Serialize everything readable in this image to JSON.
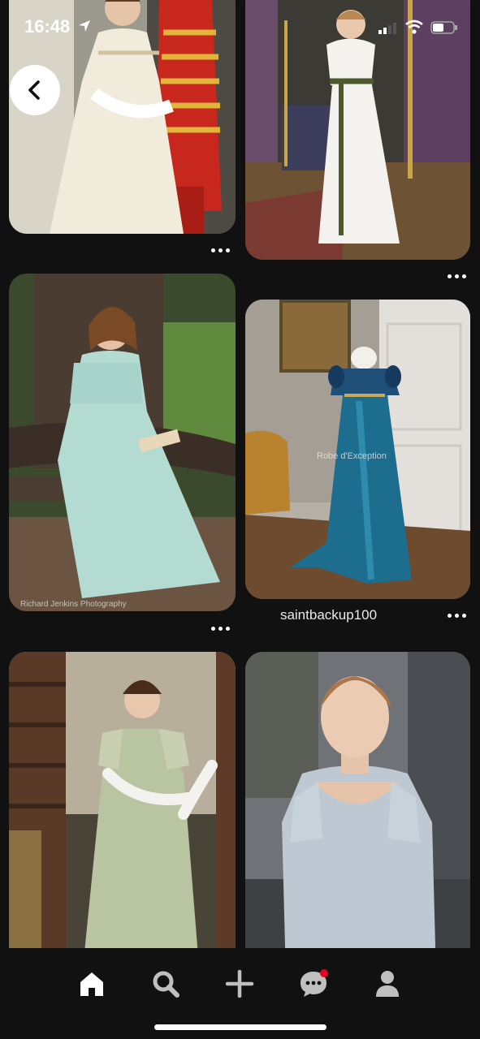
{
  "status_bar": {
    "time": "16:48"
  },
  "feed": {
    "pins": [
      {
        "id": "regency-white-gown-guard",
        "caption": ""
      },
      {
        "id": "lace-gown-green-sash",
        "caption": ""
      },
      {
        "id": "reading-blue-dress-tree",
        "caption": "",
        "watermark": "Richard Jenkins Photography"
      },
      {
        "id": "teal-silk-gown-mannequin",
        "caption": "saintbackup100",
        "watermark": "Robe d'Exception"
      },
      {
        "id": "green-lace-gown-staircase",
        "caption": ""
      },
      {
        "id": "pale-blue-gown-portrait",
        "caption": ""
      }
    ]
  },
  "bottom_nav": {
    "items": [
      "home",
      "search",
      "create",
      "messages",
      "profile"
    ],
    "messages_has_notification": true
  },
  "colors": {
    "background": "#111111",
    "accent": "#e60023"
  }
}
